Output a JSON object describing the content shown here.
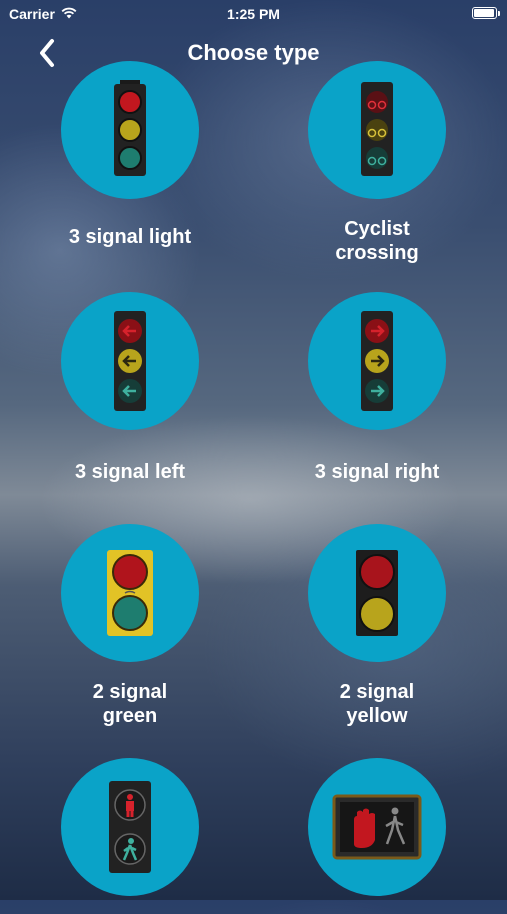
{
  "status_bar": {
    "carrier": "Carrier",
    "time": "1:25 PM",
    "battery_level": 1.0
  },
  "nav": {
    "title": "Choose type",
    "back_icon": "chevron-left-icon"
  },
  "items": [
    {
      "label": "3 signal light",
      "icon": "traffic-light-3-signal-icon"
    },
    {
      "label": "Cyclist crossing",
      "icon": "cyclist-crossing-light-icon"
    },
    {
      "label": "3 signal left",
      "icon": "traffic-light-left-arrow-icon"
    },
    {
      "label": "3 signal right",
      "icon": "traffic-light-right-arrow-icon"
    },
    {
      "label": "2 signal green",
      "icon": "two-signal-green-light-icon"
    },
    {
      "label": "2 signal yellow",
      "icon": "two-signal-yellow-light-icon"
    },
    {
      "label": "",
      "icon": "pedestrian-signal-icon"
    },
    {
      "label": "",
      "icon": "pedestrian-box-signal-icon"
    }
  ],
  "colors": {
    "circle": "#0aa3c8",
    "red_lamp": "#c2171f",
    "yellow_lamp": "#b8a41c",
    "green_lamp": "#1e7d6f"
  }
}
